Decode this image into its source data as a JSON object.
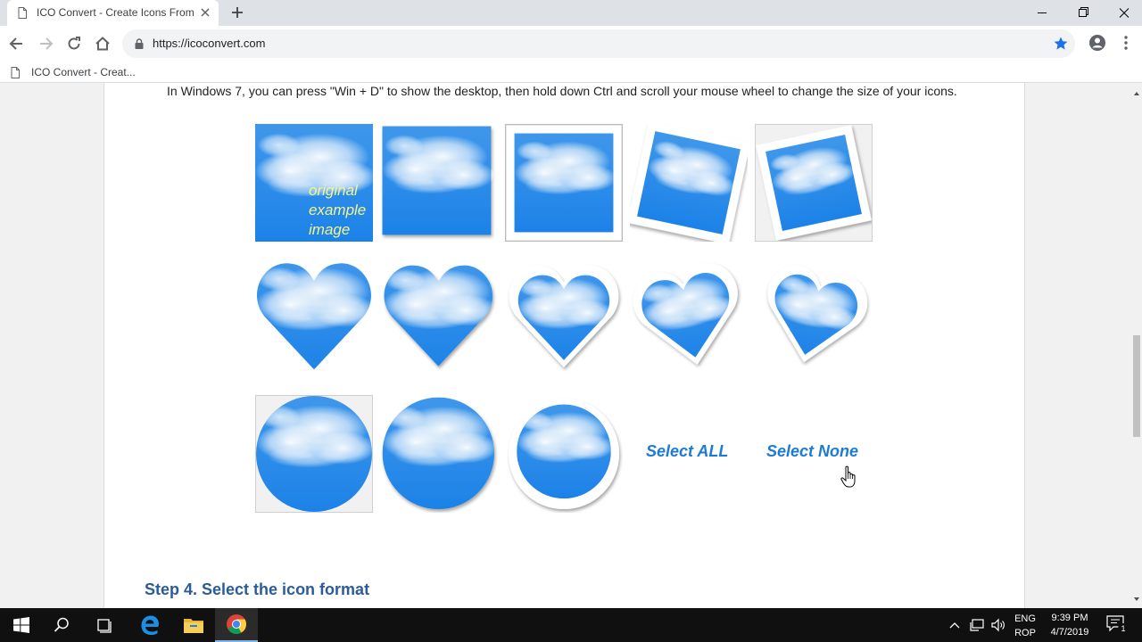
{
  "browser": {
    "tab_title": "ICO Convert - Create Icons From",
    "url": "https://icoconvert.com",
    "bookmark_label": "ICO Convert - Creat..."
  },
  "page": {
    "intro_text": "In Windows 7, you can press \"Win + D\" to show the desktop, then hold down Ctrl and scroll your mouse wheel to change the size of your icons.",
    "original_label_lines": [
      "original",
      "example",
      "image"
    ],
    "styles": [
      {
        "shape": "square",
        "variant": "original"
      },
      {
        "shape": "square",
        "variant": "shadow"
      },
      {
        "shape": "square",
        "variant": "white-border"
      },
      {
        "shape": "square",
        "variant": "tilted-border"
      },
      {
        "shape": "square",
        "variant": "tilted-border-selected",
        "selected": true
      },
      {
        "shape": "heart",
        "variant": "plain"
      },
      {
        "shape": "heart",
        "variant": "shadow"
      },
      {
        "shape": "heart",
        "variant": "white-border"
      },
      {
        "shape": "heart",
        "variant": "tilted-left"
      },
      {
        "shape": "heart",
        "variant": "tilted-right"
      },
      {
        "shape": "circle",
        "variant": "plain-selected",
        "selected": true
      },
      {
        "shape": "circle",
        "variant": "shadow"
      },
      {
        "shape": "circle",
        "variant": "white-border"
      }
    ],
    "select_all_label": "Select ALL",
    "select_none_label": "Select None",
    "step_heading": "Step 4. Select the icon format"
  },
  "taskbar": {
    "lang_line1": "ENG",
    "lang_line2": "ROP",
    "time": "9:39 PM",
    "date": "4/7/2019",
    "notification_count": "1"
  },
  "colors": {
    "sky_blue": "#2385e6",
    "link_blue": "#1e7bd4",
    "heading_blue": "#2a5b9b",
    "star_blue": "#1a73e8"
  }
}
